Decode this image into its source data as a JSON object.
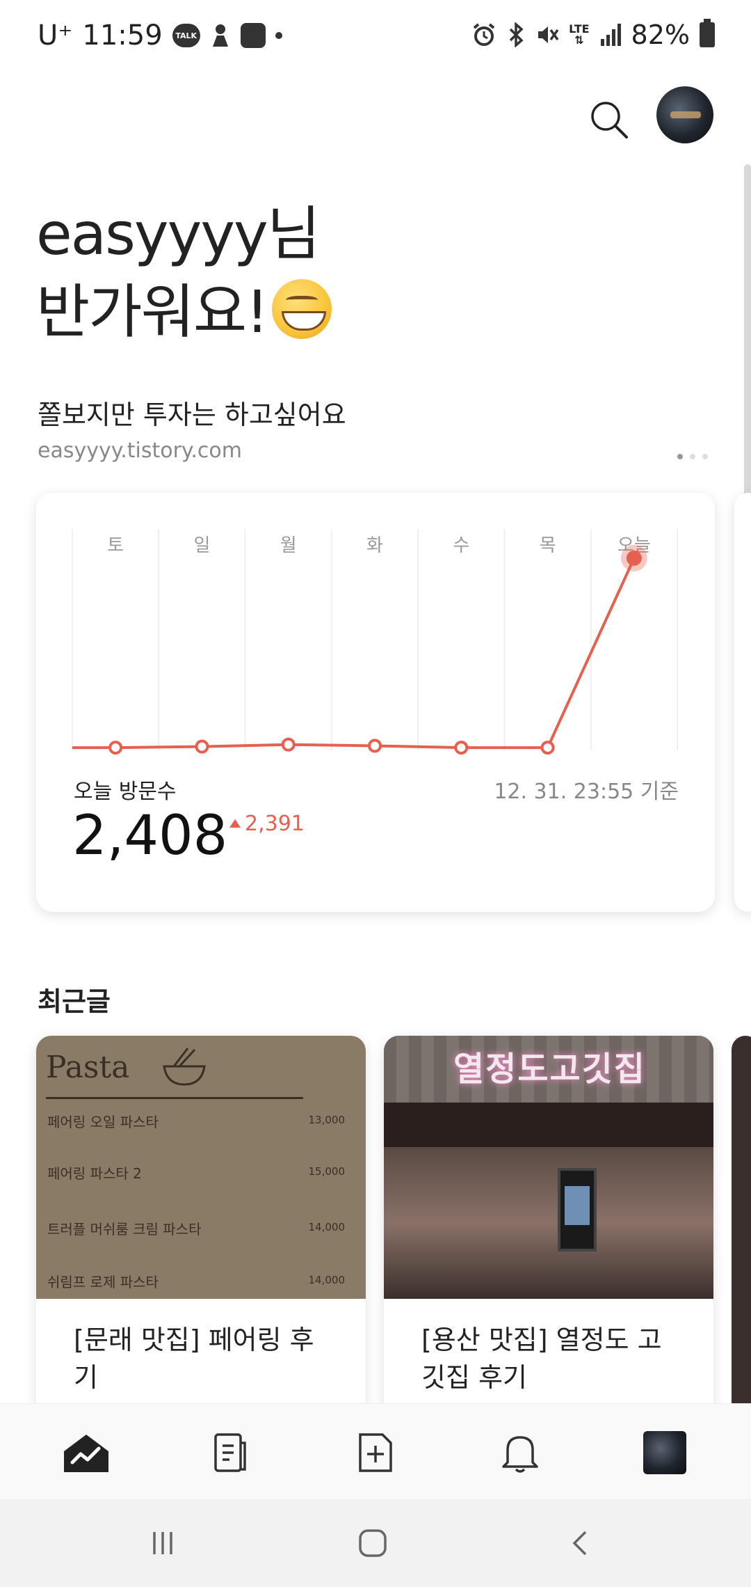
{
  "status_bar": {
    "carrier": "U⁺",
    "time": "11:59",
    "talk_badge": "TALK",
    "network": "LTE",
    "battery": "82%"
  },
  "greeting": {
    "line1": "easyyyy님",
    "line2": "반가워요!"
  },
  "blog": {
    "title": "쫄보지만 투자는 하고싶어요",
    "url": "easyyyy.tistory.com"
  },
  "stats": {
    "visit_label": "오늘 방문수",
    "timestamp": "12. 31. 23:55 기준",
    "count": "2,408",
    "delta": "2,391",
    "accent_color": "#e5604f"
  },
  "chart_data": {
    "type": "line",
    "categories": [
      "토",
      "일",
      "월",
      "화",
      "수",
      "목",
      "오늘"
    ],
    "values": [
      17,
      30,
      55,
      40,
      17,
      17,
      2408
    ],
    "ylim": [
      0,
      2600
    ],
    "grid": true,
    "line_color": "#e5604f"
  },
  "recent": {
    "title": "최근글",
    "posts": [
      {
        "title": "[문래 맛집] 페어링 후기",
        "thumb": {
          "head": "Pasta",
          "items": [
            {
              "name": "페어링 오일 파스타",
              "price": "13,000"
            },
            {
              "name": "페어링 파스타 2",
              "price": "15,000"
            },
            {
              "name": "트러플 머쉬룸 크림 파스타",
              "price": "14,000"
            },
            {
              "name": "쉬림프 로제 파스타",
              "price": "14,000"
            }
          ]
        }
      },
      {
        "title": "[용산 맛집] 열정도 고깃집 후기",
        "thumb": {
          "sign": "열정도고깃집"
        }
      }
    ]
  },
  "bottom_nav": {
    "items": [
      "stats-icon",
      "posts-icon",
      "write-icon",
      "bell-icon",
      "profile-thumb"
    ]
  }
}
